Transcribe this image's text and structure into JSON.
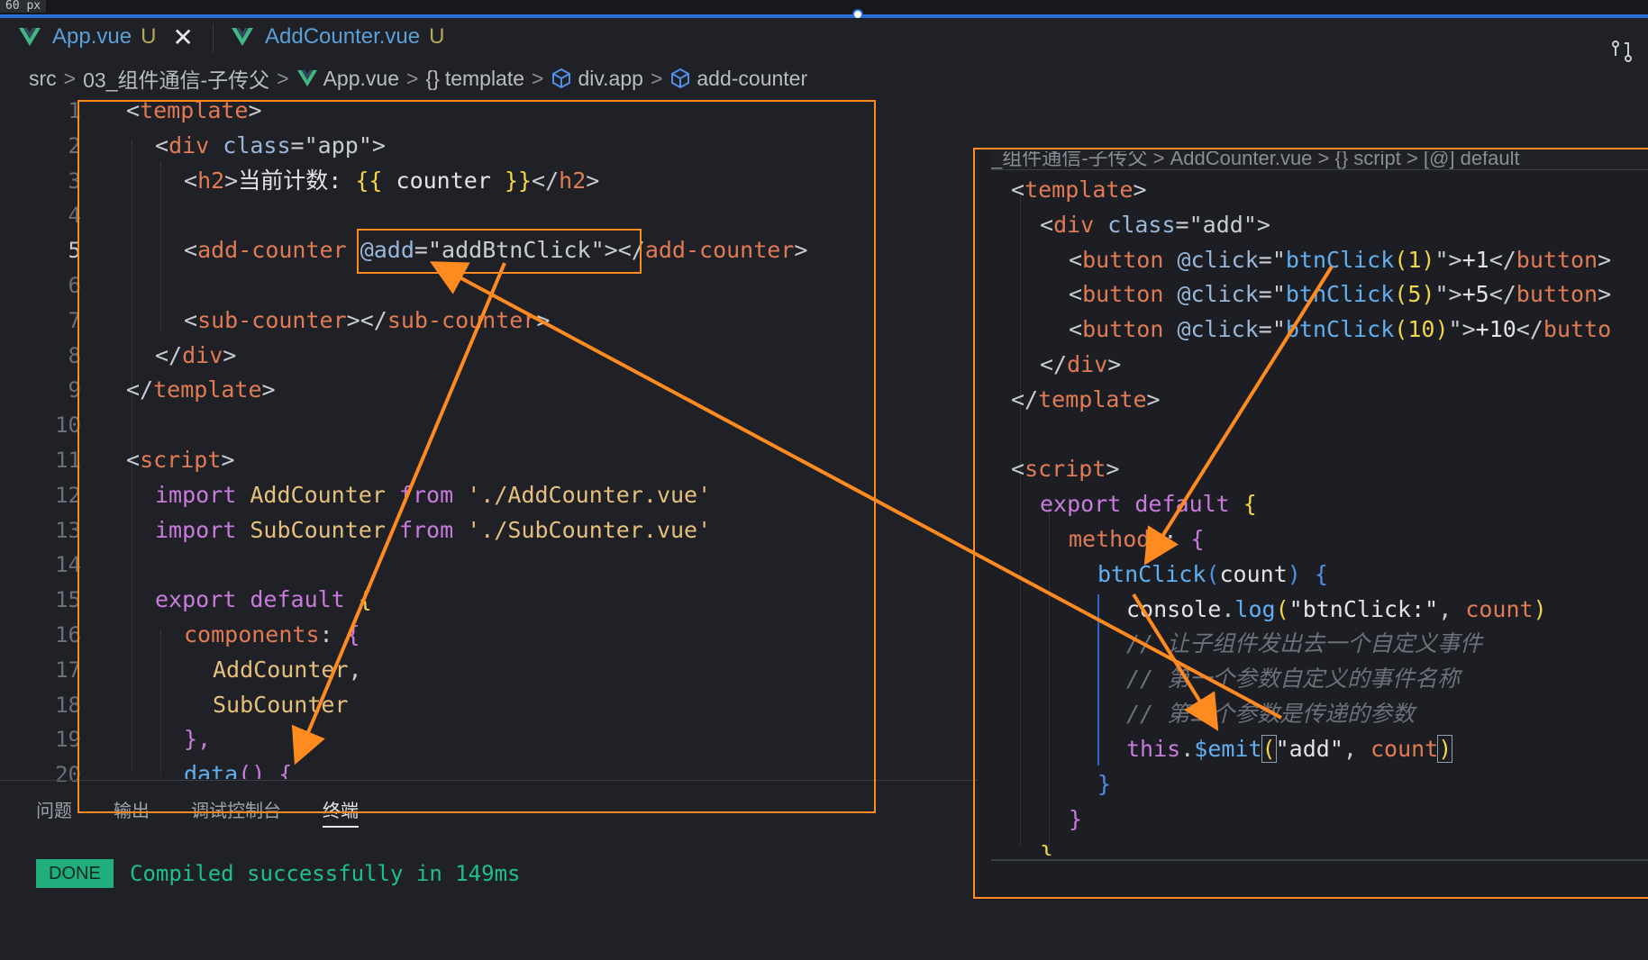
{
  "header": {
    "px_label": "60 px"
  },
  "tabs": [
    {
      "name": "App.vue",
      "status": "U",
      "closable": true
    },
    {
      "name": "AddCounter.vue",
      "status": "U",
      "closable": false
    }
  ],
  "breadcrumb": [
    "src",
    "03_组件通信-子传父",
    "App.vue",
    "template",
    "div.app",
    "add-counter"
  ],
  "left_editor": {
    "line_numbers": [
      "1",
      "2",
      "3",
      "4",
      "5",
      "6",
      "7",
      "8",
      "9",
      "10",
      "11",
      "12",
      "13",
      "14",
      "15",
      "16",
      "17",
      "18",
      "19",
      "20"
    ],
    "active_line": "5",
    "l1": {
      "open": "<",
      "tag": "template",
      "close": ">"
    },
    "l2": {
      "open": "<",
      "tag": "div",
      "attr": "class",
      "eq": "=",
      "value": "\"app\"",
      "close": ">"
    },
    "l3": {
      "open": "<",
      "tag": "h2",
      "close": ">",
      "text": "当前计数: ",
      "mo": "{{",
      "var": "counter",
      "mc": "}}",
      "end_open": "</",
      "end_tag": "h2",
      "end_close": ">"
    },
    "l5": {
      "open": "<",
      "tag": "add-counter",
      "attr": "@add",
      "eq": "=",
      "value": "\"addBtnClick\"",
      "close": ">",
      "end_open": "</",
      "end_tag": "add-counter",
      "end_close": ">"
    },
    "l7": {
      "open": "<",
      "tag": "sub-counter",
      "close": ">",
      "end_open": "</",
      "end_tag": "sub-counter",
      "end_close": ">"
    },
    "l8": {
      "end_open": "</",
      "tag": "div",
      "close": ">"
    },
    "l9": {
      "end_open": "</",
      "tag": "template",
      "close": ">"
    },
    "l11": {
      "open": "<",
      "tag": "script",
      "close": ">"
    },
    "l12": {
      "kw": "import",
      "id": "AddCounter",
      "from": "from",
      "path": "'./AddCounter.vue'"
    },
    "l13": {
      "kw": "import",
      "id": "SubCounter",
      "from": "from",
      "path": "'./SubCounter.vue'"
    },
    "l15": {
      "kw1": "export",
      "kw2": "default",
      "brace": "{"
    },
    "l16": {
      "key": "components",
      "colon": ":",
      "brace": "{"
    },
    "l17": {
      "text": "AddCounter",
      "comma": ","
    },
    "l18": {
      "text": "SubCounter"
    },
    "l19": {
      "text": "},"
    },
    "l20": {
      "fn": "data",
      "paren": "()",
      "brace": "{"
    }
  },
  "bottom_panel": {
    "tabs": [
      "问题",
      "输出",
      "调试控制台",
      "终端"
    ],
    "active_tab": "终端",
    "done_badge": "DONE",
    "message": "Compiled successfully in 149ms"
  },
  "right_editor": {
    "breadcrumb_fragment": "_组件通信-子传父 > AddCounter.vue > {} script > [@] default",
    "r1": {
      "open": "<",
      "tag": "template",
      "close": ">"
    },
    "r2": {
      "open": "<",
      "tag": "div",
      "attr": "class",
      "eq": "=",
      "value": "\"add\"",
      "close": ">"
    },
    "r3": {
      "open": "<",
      "tag": "button",
      "attr": "@click",
      "eq": "=",
      "q": "\"",
      "fn": "btnClick",
      "arg": "(1)",
      "q2": "\"",
      "close": ">",
      "text": "+1",
      "end_open": "</",
      "end_tag": "button",
      "end_close": ">"
    },
    "r4": {
      "open": "<",
      "tag": "button",
      "attr": "@click",
      "eq": "=",
      "q": "\"",
      "fn": "btnClick",
      "arg": "(5)",
      "q2": "\"",
      "close": ">",
      "text": "+5",
      "end_open": "</",
      "end_tag": "button",
      "end_close": ">"
    },
    "r5": {
      "open": "<",
      "tag": "button",
      "attr": "@click",
      "eq": "=",
      "q": "\"",
      "fn": "btnClick",
      "arg": "(10)",
      "q2": "\"",
      "close": ">",
      "text": "+10",
      "end_open": "</",
      "end_tag": "butto"
    },
    "r6": {
      "end_open": "</",
      "tag": "div",
      "close": ">"
    },
    "r7": {
      "end_open": "</",
      "tag": "template",
      "close": ">"
    },
    "r9": {
      "open": "<",
      "tag": "script",
      "close": ">"
    },
    "r10": {
      "kw1": "export",
      "kw2": "default",
      "brace": "{"
    },
    "r11": {
      "key": "methods",
      "colon": ":",
      "brace": "{"
    },
    "r12": {
      "fn": "btnClick",
      "p1": "(",
      "arg": "count",
      "p2": ")",
      "brace": "{"
    },
    "r13": {
      "obj": "console",
      "dot": ".",
      "fn": "log",
      "p1": "(",
      "str": "\"btnClick:\"",
      "comma": ", ",
      "arg": "count",
      "p2": ")"
    },
    "r14": {
      "comment": "// 让子组件发出去一个自定义事件"
    },
    "r15": {
      "comment": "// 第一个参数自定义的事件名称"
    },
    "r16": {
      "comment": "// 第二个参数是传递的参数"
    },
    "r17": {
      "this": "this",
      "dot": ".",
      "fn": "$emit",
      "p1": "(",
      "str": "\"add\"",
      "comma": ", ",
      "arg": "count",
      "p2": ")"
    },
    "r18": {
      "brace": "}"
    },
    "r19": {
      "brace": "}"
    },
    "r20": {
      "brace": "}"
    }
  },
  "colors": {
    "highlight": "#ff8a1f",
    "tag": "#e07b53",
    "keyword": "#c97bdc",
    "function": "#61afef",
    "done": "#1fae7c"
  }
}
